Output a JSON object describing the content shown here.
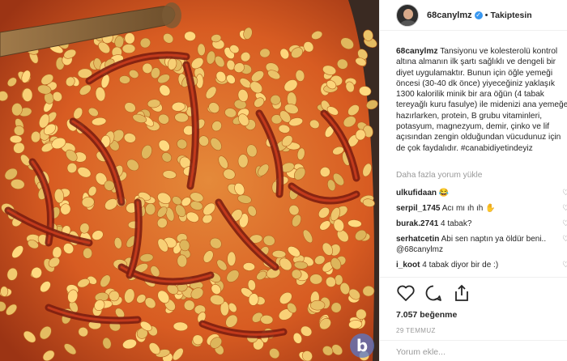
{
  "post": {
    "username": "68canylmz",
    "separator": "•",
    "follow_status": "Takiptesin",
    "caption_user": "68canylmz",
    "caption_text": " Tansiyonu ve kolesterolü kontrol altına almanın ilk şartı sağlıklı ve dengeli bir diyet uygulamaktır. Bunun için öğle yemeği öncesi (30-40 dk önce) yiyeceğiniz yaklaşık 1300 kalorilik minik bir ara öğün (4 tabak tereyağlı kuru fasulye) ile midenizi ana yemeğe hazırlarken, protein, B grubu vitaminleri, potasyum, magnezyum, demir, çinko ve lif açısından zengin olduğundan vücudunuz için de çok faydalıdır. #canabidiyetindeyiz",
    "more_comments": "Daha fazla yorum yükle",
    "likes": "7.057 beğenme",
    "date": "29 TEMMUZ",
    "comment_placeholder": "Yorum ekle..."
  },
  "comments": [
    {
      "user": "ulkufidaan",
      "text": " 😂"
    },
    {
      "user": "serpil_1745",
      "text": " Acı mı ıh ıh ✋"
    },
    {
      "user": "burak.2741",
      "text": " 4 tabak?"
    },
    {
      "user": "serhatcetin",
      "text": " Abi sen naptın ya öldür beni.. @68canylmz"
    },
    {
      "user": "i_koot",
      "text": " 4 tabak diyor bir de :)"
    }
  ],
  "photo": {
    "watermark": "b",
    "description_icon": "food-photo"
  },
  "colors": {
    "accent": "#3897f0",
    "muted": "#999999",
    "text": "#262626"
  }
}
